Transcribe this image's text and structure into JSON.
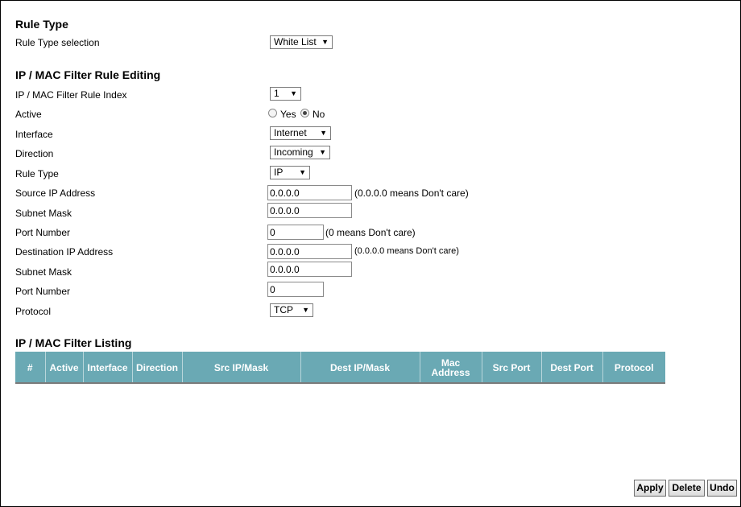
{
  "rule_type_section": {
    "title": "Rule Type",
    "selection_label": "Rule Type selection",
    "selection_value": "White List"
  },
  "editing_section": {
    "title": "IP / MAC Filter Rule Editing",
    "index_label": "IP / MAC Filter Rule Index",
    "index_value": "1",
    "active_label": "Active",
    "active_options": [
      {
        "label": "Yes",
        "checked": false
      },
      {
        "label": "No",
        "checked": true
      }
    ],
    "interface_label": "Interface",
    "interface_value": "Internet",
    "direction_label": "Direction",
    "direction_value": "Incoming",
    "rule_type_label": "Rule Type",
    "rule_type_value": "IP",
    "source_ip_label": "Source IP Address",
    "source_ip_value": "0.0.0.0",
    "source_ip_hint": "(0.0.0.0 means Don't care)",
    "source_mask_label": "Subnet Mask",
    "source_mask_value": "0.0.0.0",
    "source_port_label": "Port Number",
    "source_port_value": "0",
    "source_port_hint": "(0 means Don't care)",
    "dest_ip_label": "Destination IP Address",
    "dest_ip_value": "0.0.0.0",
    "dest_ip_hint": "(0.0.0.0 means Don't care)",
    "dest_mask_label": "Subnet Mask",
    "dest_mask_value": "0.0.0.0",
    "dest_port_label": "Port Number",
    "dest_port_value": "0",
    "protocol_label": "Protocol",
    "protocol_value": "TCP"
  },
  "listing_section": {
    "title": "IP / MAC Filter Listing",
    "columns": [
      "#",
      "Active",
      "Interface",
      "Direction",
      "Src IP/Mask",
      "Dest IP/Mask",
      "Mac Address",
      "Src Port",
      "Dest Port",
      "Protocol"
    ]
  },
  "buttons": {
    "apply": "Apply",
    "delete": "Delete",
    "undo": "Undo"
  },
  "colors": {
    "table_header": "#6aa9b4"
  }
}
